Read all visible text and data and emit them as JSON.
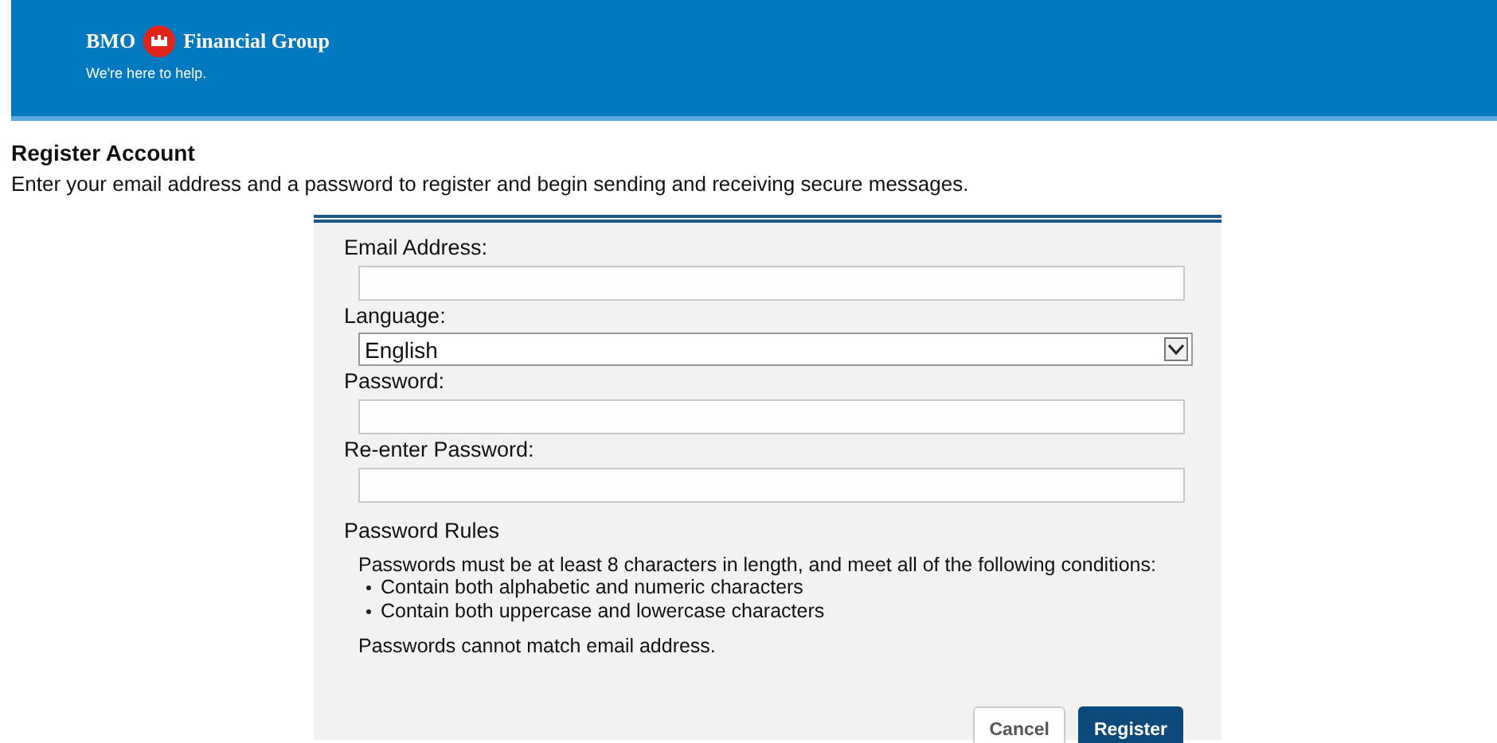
{
  "header": {
    "brand_left": "BMO",
    "brand_right": "Financial Group",
    "tagline": "We're here to help."
  },
  "title": "Register Account",
  "intro": "Enter your email address and a password to register and begin sending and receiving secure messages.",
  "form": {
    "fields": [
      {
        "label": "Email Address:",
        "kind": "text"
      },
      {
        "label": "Language:",
        "kind": "select",
        "value": "English"
      },
      {
        "label": "Password:",
        "kind": "password"
      },
      {
        "label": "Re-enter Password:",
        "kind": "password"
      }
    ],
    "rules": {
      "heading": "Password Rules",
      "text": "Passwords must be at least 8 characters in length, and meet all of the following conditions:",
      "items": [
        "Contain both alphabetic and numeric characters",
        "Contain both uppercase and lowercase characters"
      ],
      "note": "Passwords cannot match email address."
    },
    "buttons": [
      {
        "label": "Cancel",
        "kind": "secondary"
      },
      {
        "label": "Register",
        "kind": "primary"
      }
    ]
  }
}
